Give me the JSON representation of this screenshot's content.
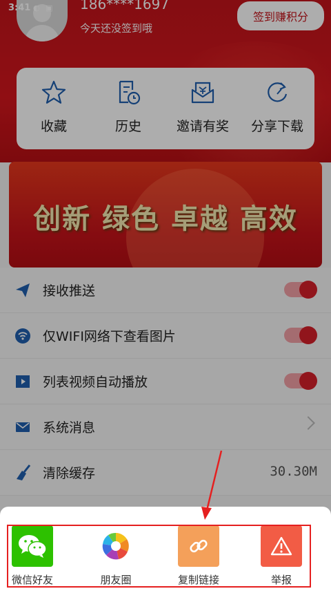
{
  "status_bar": {
    "time": "3:41"
  },
  "profile": {
    "phone": "186****1697",
    "subtitle": "今天还没签到哦",
    "signin_label": "签到赚积分"
  },
  "quick_actions": [
    {
      "label": "收藏",
      "icon": "star-icon"
    },
    {
      "label": "历史",
      "icon": "history-icon"
    },
    {
      "label": "邀请有奖",
      "icon": "invite-icon"
    },
    {
      "label": "分享下载",
      "icon": "share-refresh-icon"
    }
  ],
  "banner": {
    "text": "创新 绿色 卓越 高效"
  },
  "settings": {
    "push_label": "接收推送",
    "wifi_images_label": "仅WIFI网络下查看图片",
    "autoplay_label": "列表视频自动播放",
    "messages_label": "系统消息",
    "clear_cache_label": "清除缓存",
    "cache_size": "30.30M"
  },
  "share_sheet": {
    "items": [
      {
        "label": "微信好友",
        "icon": "wechat-icon",
        "color": "#2dc100"
      },
      {
        "label": "朋友圈",
        "icon": "moments-icon",
        "color": "#ffffff"
      },
      {
        "label": "复制链接",
        "icon": "link-icon",
        "color": "#f4a05a"
      },
      {
        "label": "举报",
        "icon": "warning-icon",
        "color": "#f25c45"
      }
    ]
  },
  "colors": {
    "accent_red": "#c4141b",
    "annotation_red": "#e51f1f",
    "icon_blue": "#1f5fae"
  }
}
